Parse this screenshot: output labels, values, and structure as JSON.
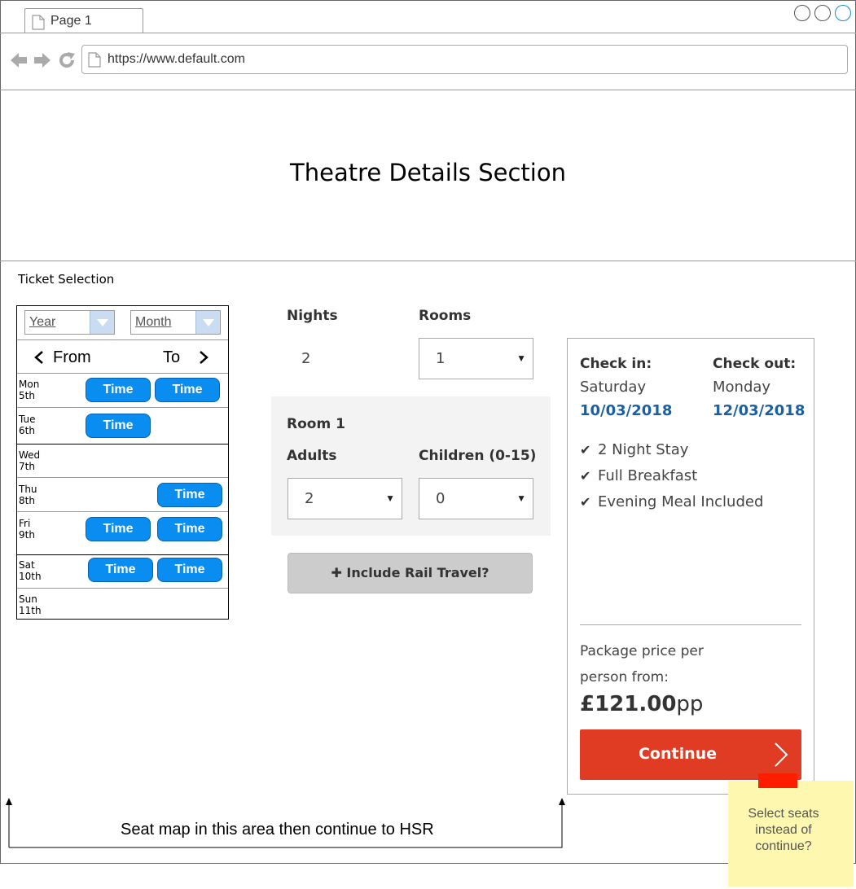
{
  "browser": {
    "tab_title": "Page 1",
    "url": "https://www.default.com",
    "accent": "#0a8df1"
  },
  "page": {
    "theatre_title": "Theatre Details Section",
    "ticket_label": "Ticket Selection"
  },
  "calendar": {
    "year_placeholder": "Year",
    "month_placeholder": "Month",
    "from_label": "From",
    "to_label": "To",
    "time_label": "Time",
    "days": [
      {
        "name": "Mon",
        "date": "5th"
      },
      {
        "name": "Tue",
        "date": "6th"
      },
      {
        "name": "Wed",
        "date": "7th"
      },
      {
        "name": "Thu",
        "date": "8th"
      },
      {
        "name": "Fri",
        "date": "9th"
      },
      {
        "name": "Sat",
        "date": "10th"
      },
      {
        "name": "Sun",
        "date": "11th"
      }
    ]
  },
  "booking": {
    "nights_label": "Nights",
    "nights_value": "2",
    "rooms_label": "Rooms",
    "rooms_value": "1",
    "room_title": "Room 1",
    "adults_label": "Adults",
    "adults_value": "2",
    "children_label": "Children (0-15)",
    "children_value": "0",
    "rail_button": "Include Rail Travel?"
  },
  "summary": {
    "checkin_label": "Check in:",
    "checkin_day": "Saturday",
    "checkin_date": "10/03/2018",
    "checkout_label": "Check out:",
    "checkout_day": "Monday",
    "checkout_date": "12/03/2018",
    "features": [
      "2 Night Stay",
      "Full Breakfast",
      "Evening Meal Included"
    ],
    "price_label_1": "Package price per",
    "price_label_2": "person from:",
    "price_value": "£121.00",
    "price_unit": "pp",
    "continue_button": "Continue",
    "button_color": "#e03c24"
  },
  "sticky_note": {
    "line1": "Select seats",
    "line2": "instead of",
    "line3": "continue?"
  },
  "annotation": {
    "text": "Seat map in this area then continue to HSR"
  }
}
